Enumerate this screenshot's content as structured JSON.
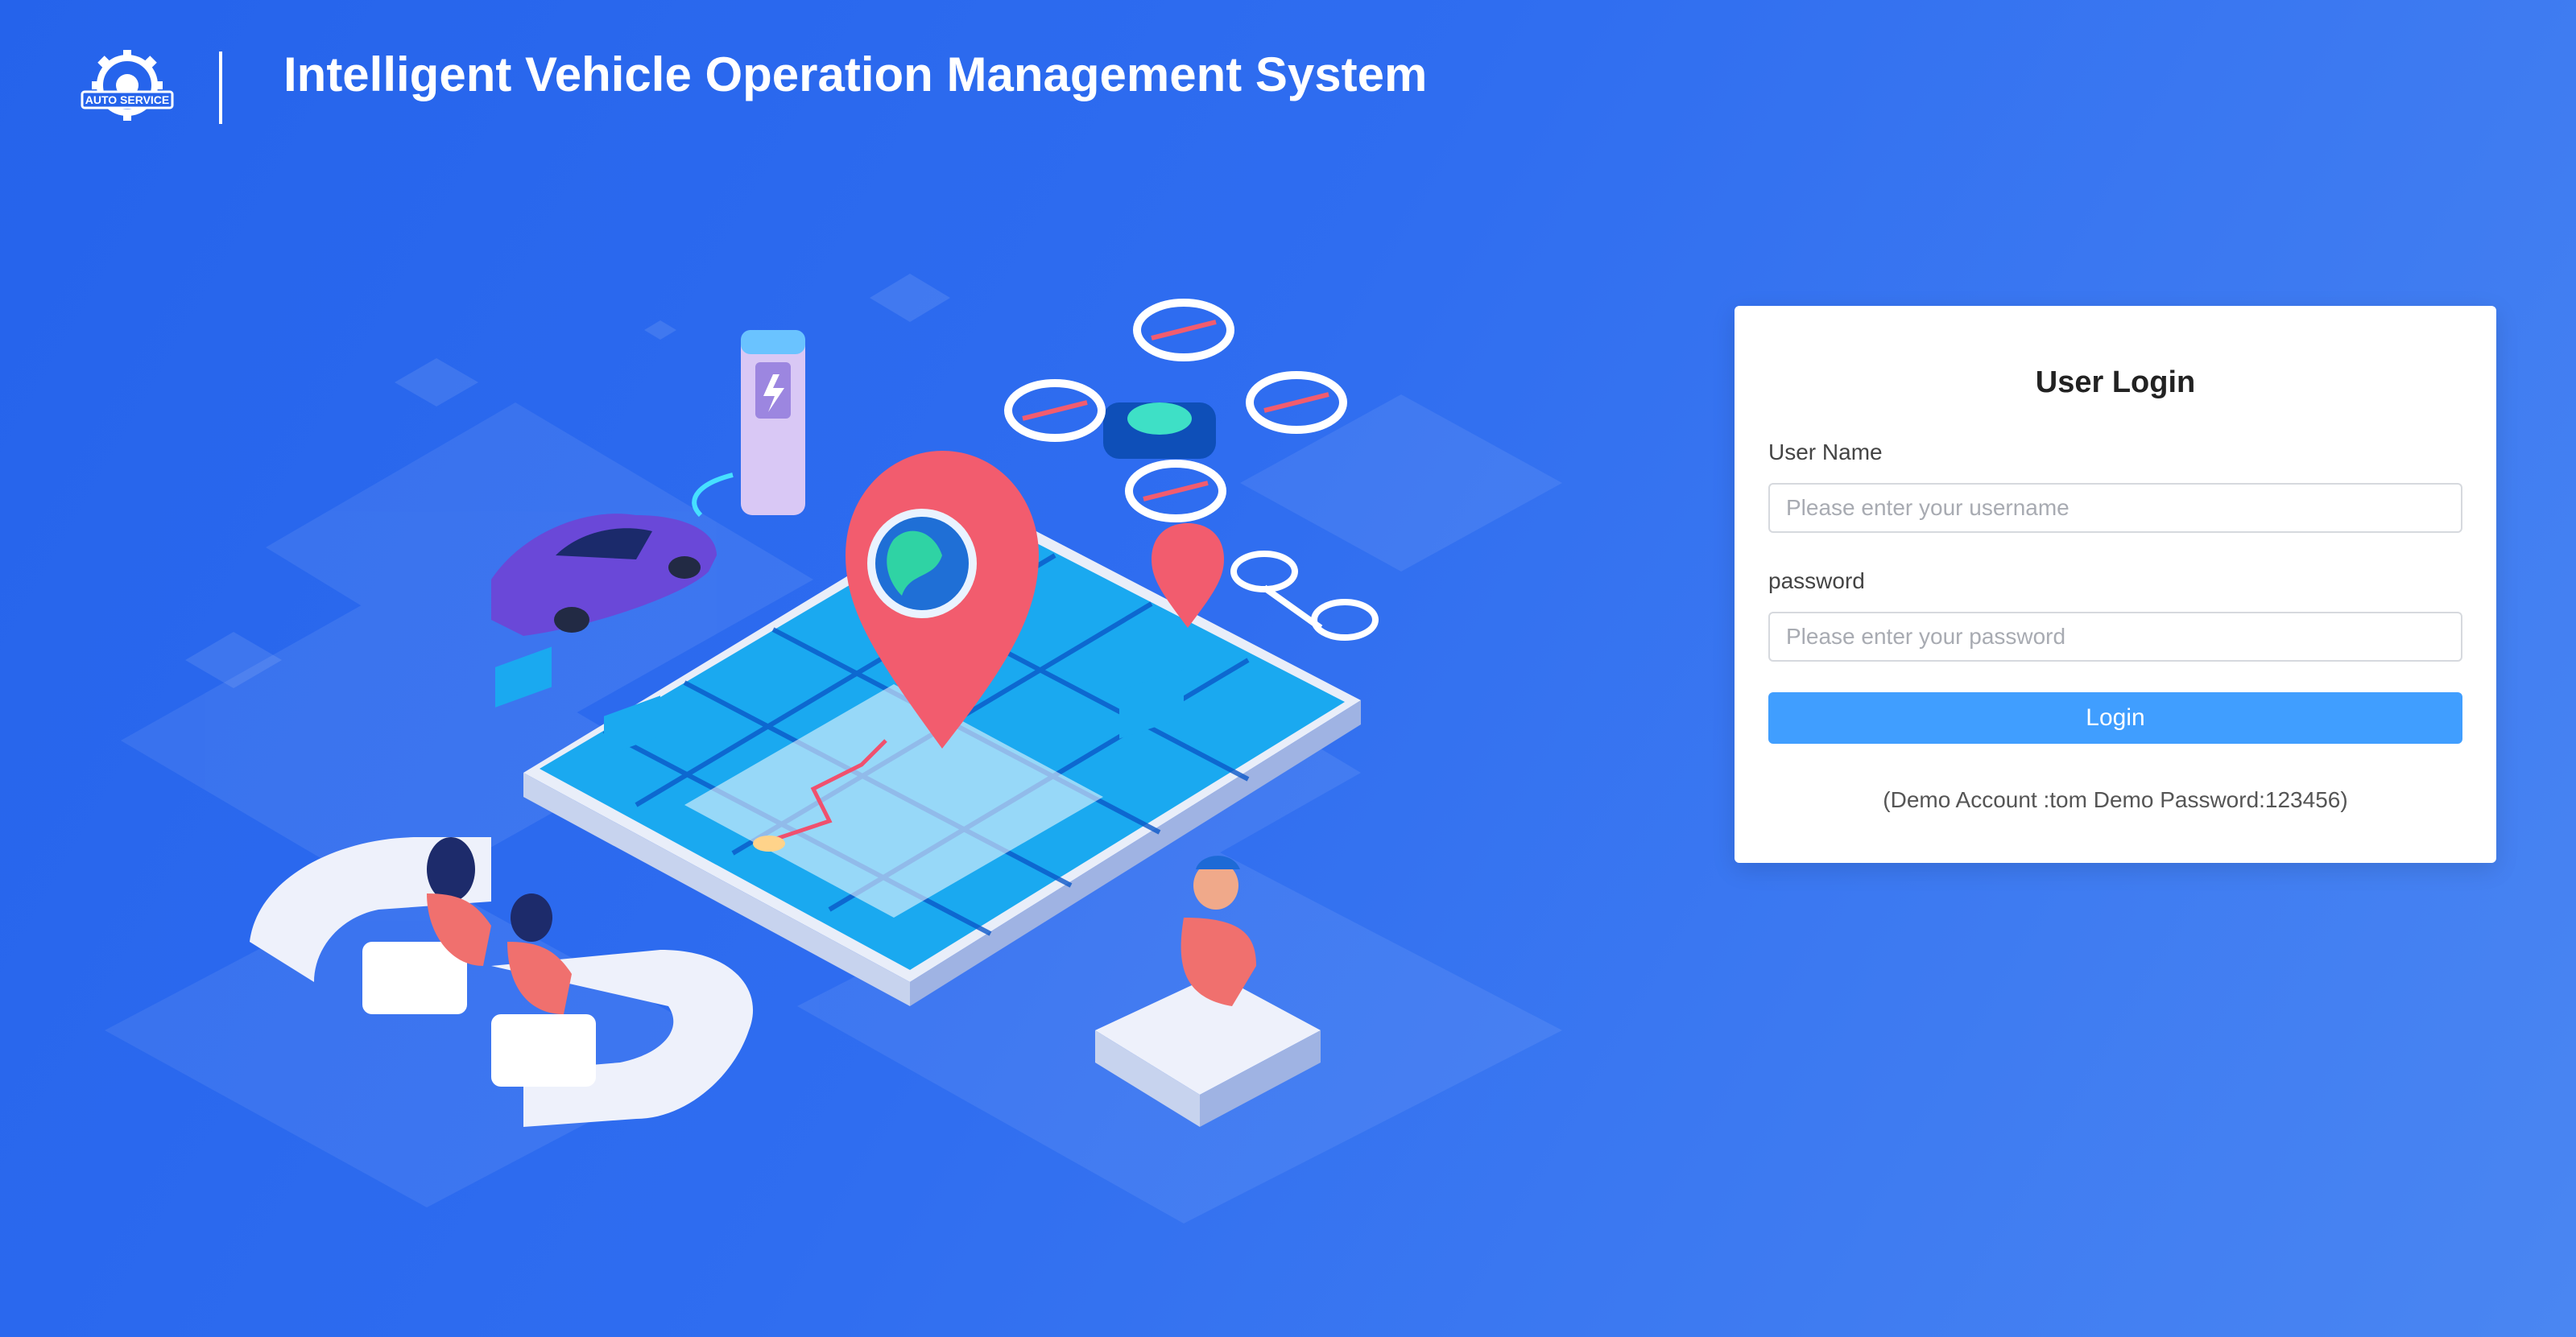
{
  "header": {
    "logo_text": "AUTO SERVICE",
    "title": "Intelligent Vehicle Operation Management System"
  },
  "login": {
    "title": "User Login",
    "username_label": "User Name",
    "username_placeholder": "Please enter your username",
    "username_value": "",
    "password_label": "password",
    "password_placeholder": "Please enter your password",
    "password_value": "",
    "login_button": "Login",
    "demo_note": "(Demo Account :tom Demo Password:123456)"
  },
  "colors": {
    "background": "#2563eb",
    "primary_button": "#409eff",
    "card": "#ffffff"
  }
}
